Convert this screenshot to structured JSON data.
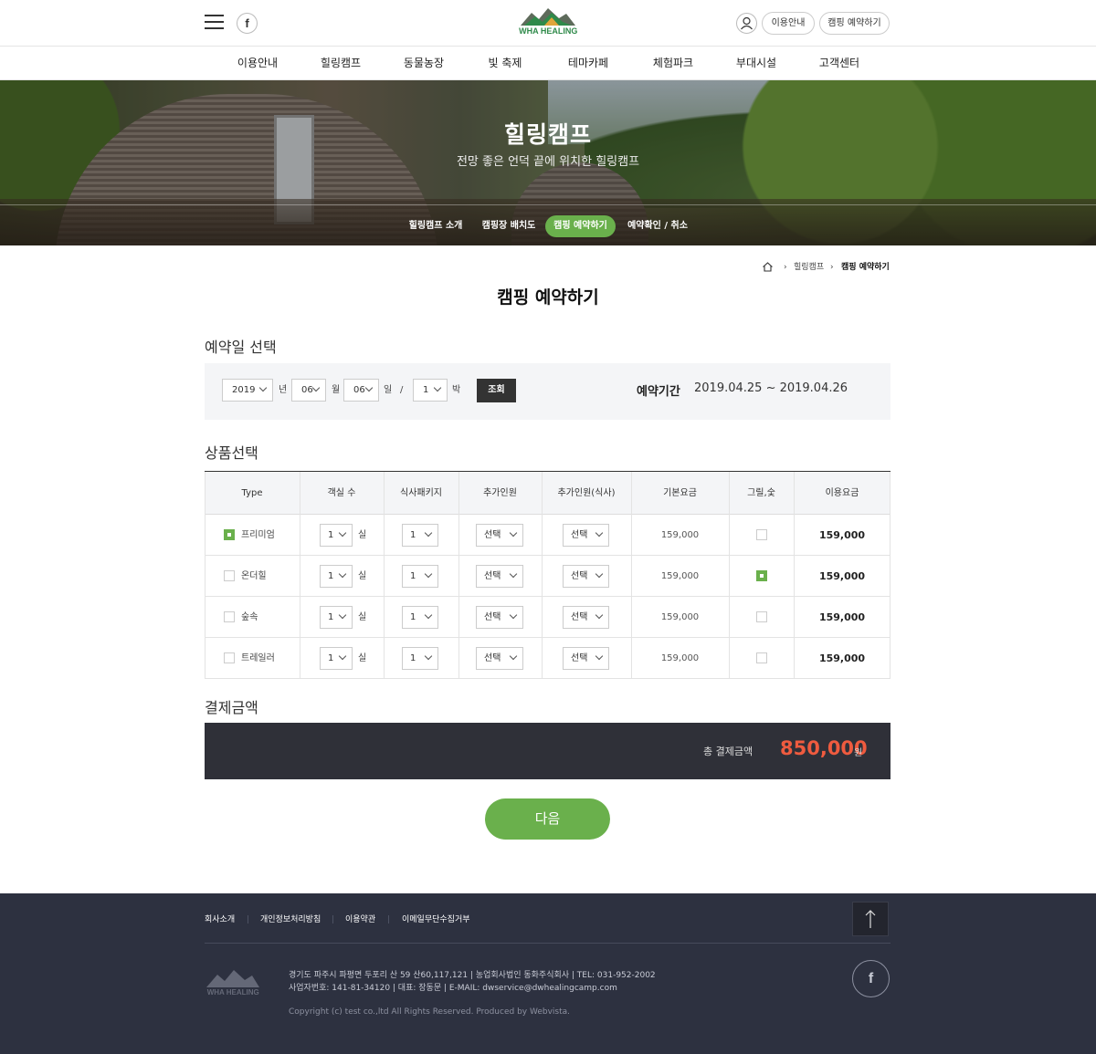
{
  "header": {
    "logo_text": "DONG WHA HEALING CAMP",
    "top_links": [
      "이용안내",
      "캠핑 예약하기"
    ]
  },
  "gnb": [
    "이용안내",
    "힐링캠프",
    "동물농장",
    "빛 축제",
    "테마카페",
    "체험파크",
    "부대시설",
    "고객센터"
  ],
  "hero": {
    "title": "힐링캠프",
    "subtitle": "전망 좋은 언덕 끝에 위치한 힐링캠프",
    "subnav": [
      "힐링캠프 소개",
      "캠핑장 배치도",
      "캠핑 예약하기",
      "예약확인 / 취소"
    ],
    "active_subnav": "캠핑 예약하기"
  },
  "breadcrumb": [
    "힐링캠프",
    "캠핑 예약하기"
  ],
  "page_title": "캠핑 예약하기",
  "date_section": {
    "title": "예약일 선택",
    "year": "2019",
    "year_unit": "년",
    "month": "06",
    "month_unit": "월",
    "day": "06",
    "day_unit": "일",
    "slash": "/",
    "nights": "1",
    "nights_unit": "박",
    "query_button": "조회",
    "period_label": "예약기간",
    "period_value": "2019.04.25 ~ 2019.04.26"
  },
  "product_section": {
    "title": "상품선택",
    "headers": [
      "Type",
      "객실 수",
      "식사패키지",
      "추가인원",
      "추가인원(식사)",
      "기본요금",
      "그릴,숯",
      "이용요금"
    ],
    "rows": [
      {
        "type": "프리미엄",
        "checked": true,
        "rooms": "1",
        "room_unit": "실",
        "meal": "1",
        "extra": "선택",
        "extra_meal": "선택",
        "base": "159,000",
        "grill": false,
        "total": "159,000"
      },
      {
        "type": "온더힐",
        "checked": false,
        "rooms": "1",
        "room_unit": "실",
        "meal": "1",
        "extra": "선택",
        "extra_meal": "선택",
        "base": "159,000",
        "grill": true,
        "total": "159,000"
      },
      {
        "type": "숲속",
        "checked": false,
        "rooms": "1",
        "room_unit": "실",
        "meal": "1",
        "extra": "선택",
        "extra_meal": "선택",
        "base": "159,000",
        "grill": false,
        "total": "159,000"
      },
      {
        "type": "트레일러",
        "checked": false,
        "rooms": "1",
        "room_unit": "실",
        "meal": "1",
        "extra": "선택",
        "extra_meal": "선택",
        "base": "159,000",
        "grill": false,
        "total": "159,000"
      }
    ]
  },
  "payment": {
    "title": "결제금액",
    "label": "총 결제금액",
    "amount": "850,000",
    "unit": "원",
    "next_button": "다음"
  },
  "footer": {
    "links": [
      "회사소개",
      "개인정보처리방침",
      "이용약관",
      "이메일무단수집거부"
    ],
    "address": "경기도 파주시 파평면 두포리 산 59 산60,117,121 | 농업회사법인 동화주식회사 | TEL: 031-952-2002",
    "biz": "사업자번호: 141-81-34120 | 대표: 장동문 | E-MAIL: dwservice@dwhealingcamp.com",
    "copyright": "Copyright (c) test co.,ltd All Rights Reserved. Produced by Webvista."
  },
  "colors": {
    "accent_green": "#6ab04c",
    "price_red": "#ef5b3f",
    "footer_bg": "#2d3140",
    "pay_bar_bg": "#2f3038"
  }
}
